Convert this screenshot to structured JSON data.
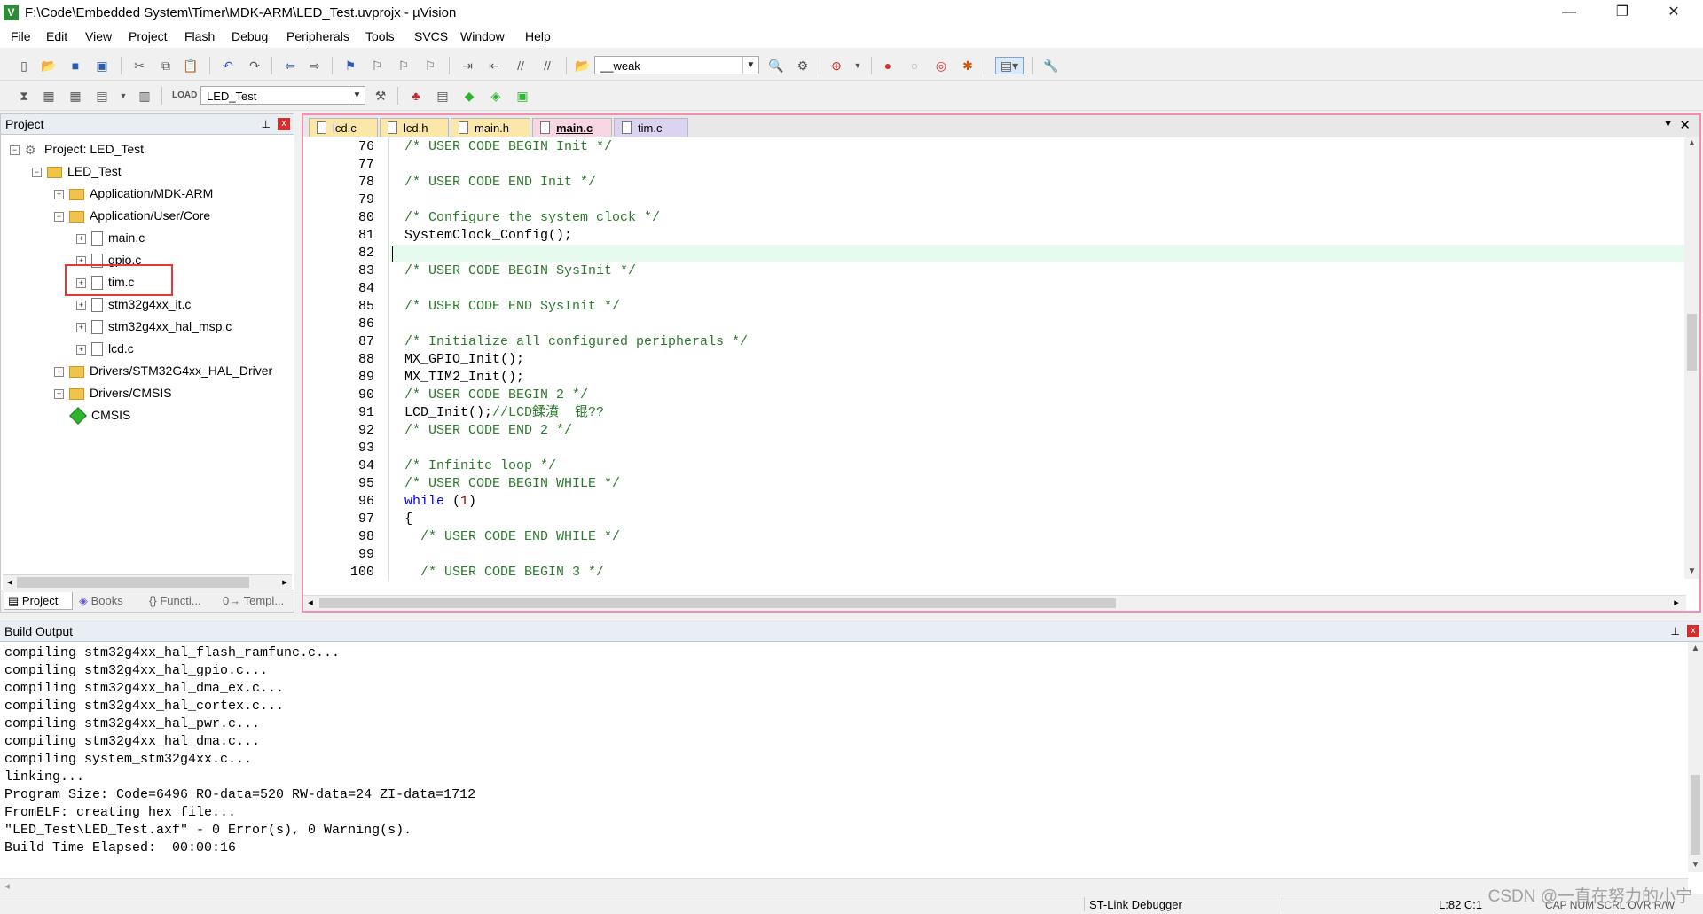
{
  "window": {
    "title": "F:\\Code\\Embedded System\\Timer\\MDK-ARM\\LED_Test.uvprojx - µVision",
    "app_icon_letter": "V",
    "minimize": "—",
    "restore": "❐",
    "close": "✕"
  },
  "menu": [
    "File",
    "Edit",
    "View",
    "Project",
    "Flash",
    "Debug",
    "Peripherals",
    "Tools",
    "SVCS",
    "Window",
    "Help"
  ],
  "toolbar1": {
    "find_combo_value": "__weak"
  },
  "toolbar2": {
    "target_combo_value": "LED_Test"
  },
  "project_panel": {
    "header": "Project",
    "pin": "⊥",
    "close": "x",
    "tree": [
      {
        "label": "Project: LED_Test",
        "expander": "−"
      },
      {
        "label": "LED_Test",
        "expander": "−"
      },
      {
        "label": "Application/MDK-ARM",
        "expander": "+"
      },
      {
        "label": "Application/User/Core",
        "expander": "−"
      },
      {
        "label": "main.c",
        "expander": "+"
      },
      {
        "label": "gpio.c",
        "expander": "+"
      },
      {
        "label": "tim.c",
        "expander": "+"
      },
      {
        "label": "stm32g4xx_it.c",
        "expander": "+"
      },
      {
        "label": "stm32g4xx_hal_msp.c",
        "expander": "+"
      },
      {
        "label": "lcd.c",
        "expander": "+"
      },
      {
        "label": "Drivers/STM32G4xx_HAL_Driver",
        "expander": "+"
      },
      {
        "label": "Drivers/CMSIS",
        "expander": "+"
      },
      {
        "label": "CMSIS",
        "expander": ""
      }
    ],
    "tabs": [
      "Project",
      "Books",
      "Functi...",
      "Templ..."
    ],
    "tab_icons": [
      "▤",
      "◈",
      "{}",
      "0→"
    ]
  },
  "editor": {
    "tabs": [
      "lcd.c",
      "lcd.h",
      "main.h",
      "main.c",
      "tim.c"
    ],
    "active_tab": "main.c",
    "line_numbers": [
      "76",
      "77",
      "78",
      "79",
      "80",
      "81",
      "82",
      "83",
      "84",
      "85",
      "86",
      "87",
      "88",
      "89",
      "90",
      "91",
      "92",
      "93",
      "94",
      "95",
      "96",
      "97",
      "98",
      "99",
      "100"
    ],
    "lines": [
      "/* USER CODE BEGIN Init */",
      "",
      "/* USER CODE END Init */",
      "",
      "/* Configure the system clock */",
      "SystemClock_Config();",
      "",
      "/* USER CODE BEGIN SysInit */",
      "",
      "/* USER CODE END SysInit */",
      "",
      "/* Initialize all configured peripherals */",
      "MX_GPIO_Init();",
      "MX_TIM2_Init();",
      "/* USER CODE BEGIN 2 */",
      "LCD_Init();//LCD鍒濆  锟??",
      "/* USER CODE END 2 */",
      "",
      "/* Infinite loop */",
      "/* USER CODE BEGIN WHILE */",
      "while (1)",
      "{",
      "  /* USER CODE END WHILE */",
      "",
      "  /* USER CODE BEGIN 3 */"
    ],
    "current_line_index": 6
  },
  "build_output": {
    "header": "Build Output",
    "pin": "⊥",
    "close": "x",
    "lines": [
      "compiling stm32g4xx_hal_flash_ramfunc.c...",
      "compiling stm32g4xx_hal_gpio.c...",
      "compiling stm32g4xx_hal_dma_ex.c...",
      "compiling stm32g4xx_hal_cortex.c...",
      "compiling stm32g4xx_hal_pwr.c...",
      "compiling stm32g4xx_hal_dma.c...",
      "compiling system_stm32g4xx.c...",
      "linking...",
      "Program Size: Code=6496 RO-data=520 RW-data=24 ZI-data=1712",
      "FromELF: creating hex file...",
      "\"LED_Test\\LED_Test.axf\" - 0 Error(s), 0 Warning(s).",
      "Build Time Elapsed:  00:00:16"
    ]
  },
  "status": {
    "debugger": "ST-Link Debugger",
    "position": "L:82 C:1",
    "indicators": "CAP  NUM  SCRL  OVR  R/W"
  },
  "watermark": "CSDN @一直在努力的小宁",
  "colors": {
    "editor_border": "#f48fb1",
    "comment": "#2b7a2b",
    "keyword": "#0000ff",
    "highlight_box": "#e53935",
    "current_line": "#e6fbee"
  }
}
